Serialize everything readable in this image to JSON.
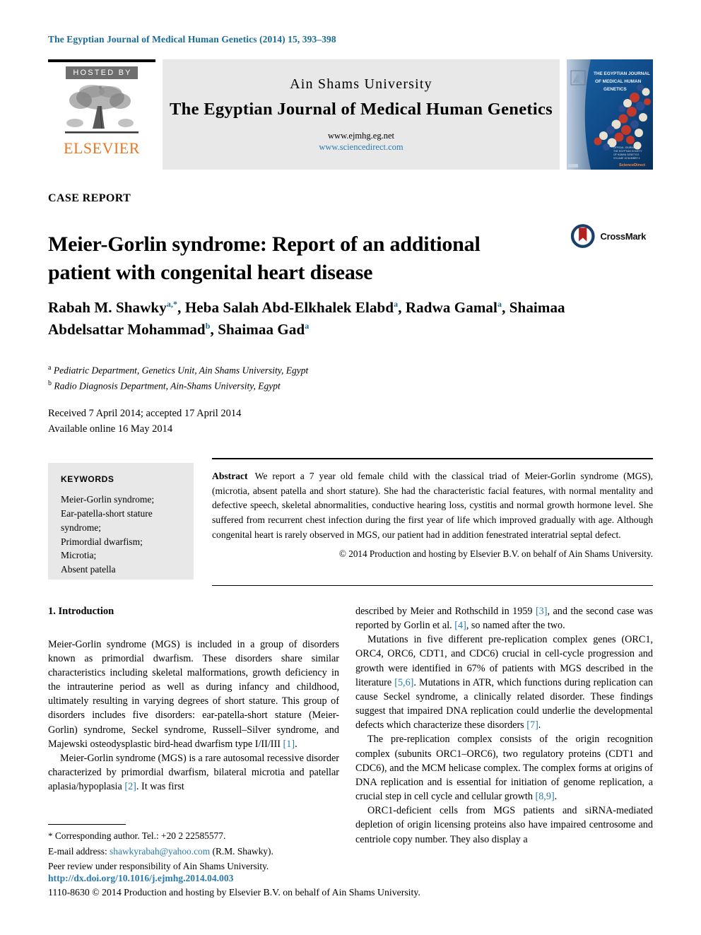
{
  "running_head": "The Egyptian Journal of Medical Human Genetics (2014) 15, 393–398",
  "masthead": {
    "hosted_by": "HOSTED BY",
    "publisher": "ELSEVIER",
    "publisher_logo_alt": "elsevier-tree-logo",
    "university": "Ain Shams University",
    "journal_title": "The Egyptian Journal of Medical Human Genetics",
    "url_journal": "www.ejmhg.eg.net",
    "url_sciencedirect": "www.sciencedirect.com",
    "cover_title_line1": "THE EGYPTIAN JOURNAL",
    "cover_title_line2": "OF MEDICAL HUMAN",
    "cover_title_line3": "GENETICS",
    "cover_footer": "Official Journal of\nAin Shams University",
    "cover_brand": "ScienceDirect"
  },
  "article": {
    "type_label": "CASE REPORT",
    "title": "Meier-Gorlin syndrome: Report of an additional patient with congenital heart disease",
    "crossmark_label": "CrossMark",
    "authors": [
      {
        "name": "Rabah M. Shawky",
        "marks": "a,*"
      },
      {
        "name": "Heba Salah Abd-Elkhalek Elabd",
        "marks": "a"
      },
      {
        "name": "Radwa Gamal",
        "marks": "a"
      },
      {
        "name": "Shaimaa Abdelsattar Mohammad",
        "marks": "b"
      },
      {
        "name": "Shaimaa Gad",
        "marks": "a"
      }
    ],
    "affiliations": [
      {
        "mark": "a",
        "text": "Pediatric Department, Genetics Unit, Ain Shams University, Egypt"
      },
      {
        "mark": "b",
        "text": "Radio Diagnosis Department, Ain-Shams University, Egypt"
      }
    ],
    "received_line": "Received 7 April 2014; accepted 17 April 2014",
    "available_line": "Available online 16 May 2014"
  },
  "keywords": {
    "heading": "KEYWORDS",
    "items": [
      "Meier-Gorlin syndrome;",
      "Ear-patella-short stature",
      "syndrome;",
      "Primordial dwarfism;",
      "Microtia;",
      "Absent patella"
    ]
  },
  "abstract": {
    "label": "Abstract",
    "text": "We report a 7 year old female child with the classical triad of Meier-Gorlin syndrome (MGS), (microtia, absent patella and short stature). She had the characteristic facial features, with normal mentality and defective speech, skeletal abnormalities, conductive hearing loss, cystitis and normal growth hormone level. She suffered from recurrent chest infection during the first year of life which improved gradually with age. Although congenital heart is rarely observed in MGS, our patient had in addition fenestrated interatrial septal defect.",
    "copyright": "© 2014 Production and hosting by Elsevier B.V. on behalf of Ain Shams University."
  },
  "body": {
    "section_heading": "1. Introduction",
    "left_para_1": "Meier-Gorlin syndrome (MGS) is included in a group of disorders known as primordial dwarfism. These disorders share similar characteristics including skeletal malformations, growth deficiency in the intrauterine period as well as during infancy and childhood, ultimately resulting in varying degrees of short stature. This group of disorders includes five disorders: ear-patella-short stature (Meier-Gorlin) syndrome, Seckel syndrome, Russell–Silver syndrome, and Majewski osteodysplastic bird-head dwarfism type I/II/III ",
    "left_para_1_ref": "[1]",
    "left_para_2_a": "Meier-Gorlin syndrome (MGS) is a rare autosomal recessive disorder characterized by primordial dwarfism, bilateral microtia and patellar aplasia/hypoplasia ",
    "left_para_2_ref": "[2]",
    "left_para_2_b": ". It was first",
    "right_para_1_a": "described by Meier and Rothschild in 1959 ",
    "right_para_1_ref1": "[3]",
    "right_para_1_b": ", and the second case was reported by Gorlin et al. ",
    "right_para_1_ref2": "[4]",
    "right_para_1_c": ", so named after the two.",
    "right_para_2_a": "Mutations in five different pre-replication complex genes (ORC1, ORC4, ORC6, CDT1, and CDC6) crucial in cell-cycle progression and growth were identified in 67% of patients with MGS described in the literature ",
    "right_para_2_ref1": "[5,6]",
    "right_para_2_b": ". Mutations in ATR, which functions during replication can cause Seckel syndrome, a clinically related disorder. These findings suggest that impaired DNA replication could underlie the developmental defects which characterize these disorders ",
    "right_para_2_ref2": "[7]",
    "right_para_2_c": ".",
    "right_para_3_a": "The pre-replication complex consists of the origin recognition complex (subunits ORC1–ORC6), two regulatory proteins (CDT1 and CDC6), and the MCM helicase complex. The complex forms at origins of DNA replication and is essential for initiation of genome replication, a crucial step in cell cycle and cellular growth ",
    "right_para_3_ref": "[8,9]",
    "right_para_3_b": ".",
    "right_para_4": "ORC1-deficient cells from MGS patients and siRNA-mediated depletion of origin licensing proteins also have impaired centrosome and centriole copy number. They also display a"
  },
  "footer": {
    "corresponding_star": "*",
    "corresponding_text": "Corresponding author. Tel.: +20 2 22585577.",
    "email_label": "E-mail address:",
    "email_address": "shawkyrabah@yahoo.com",
    "email_suffix": "(R.M. Shawky).",
    "peer_review": "Peer review under responsibility of Ain Shams University.",
    "doi": "http://dx.doi.org/10.1016/j.ejmhg.2014.04.003",
    "issn_copyright": "1110-8630 © 2014 Production and hosting by Elsevier B.V. on behalf of Ain Shams University."
  },
  "colors": {
    "journal_blue": "#1a6b96",
    "link_blue": "#2a7ab0",
    "elsevier_orange": "#e87722",
    "panel_gray": "#e8e8e8",
    "hosted_gray": "#6e6e6e",
    "crossmark_blue": "#1b3f6b",
    "crossmark_red": "#b32020"
  }
}
